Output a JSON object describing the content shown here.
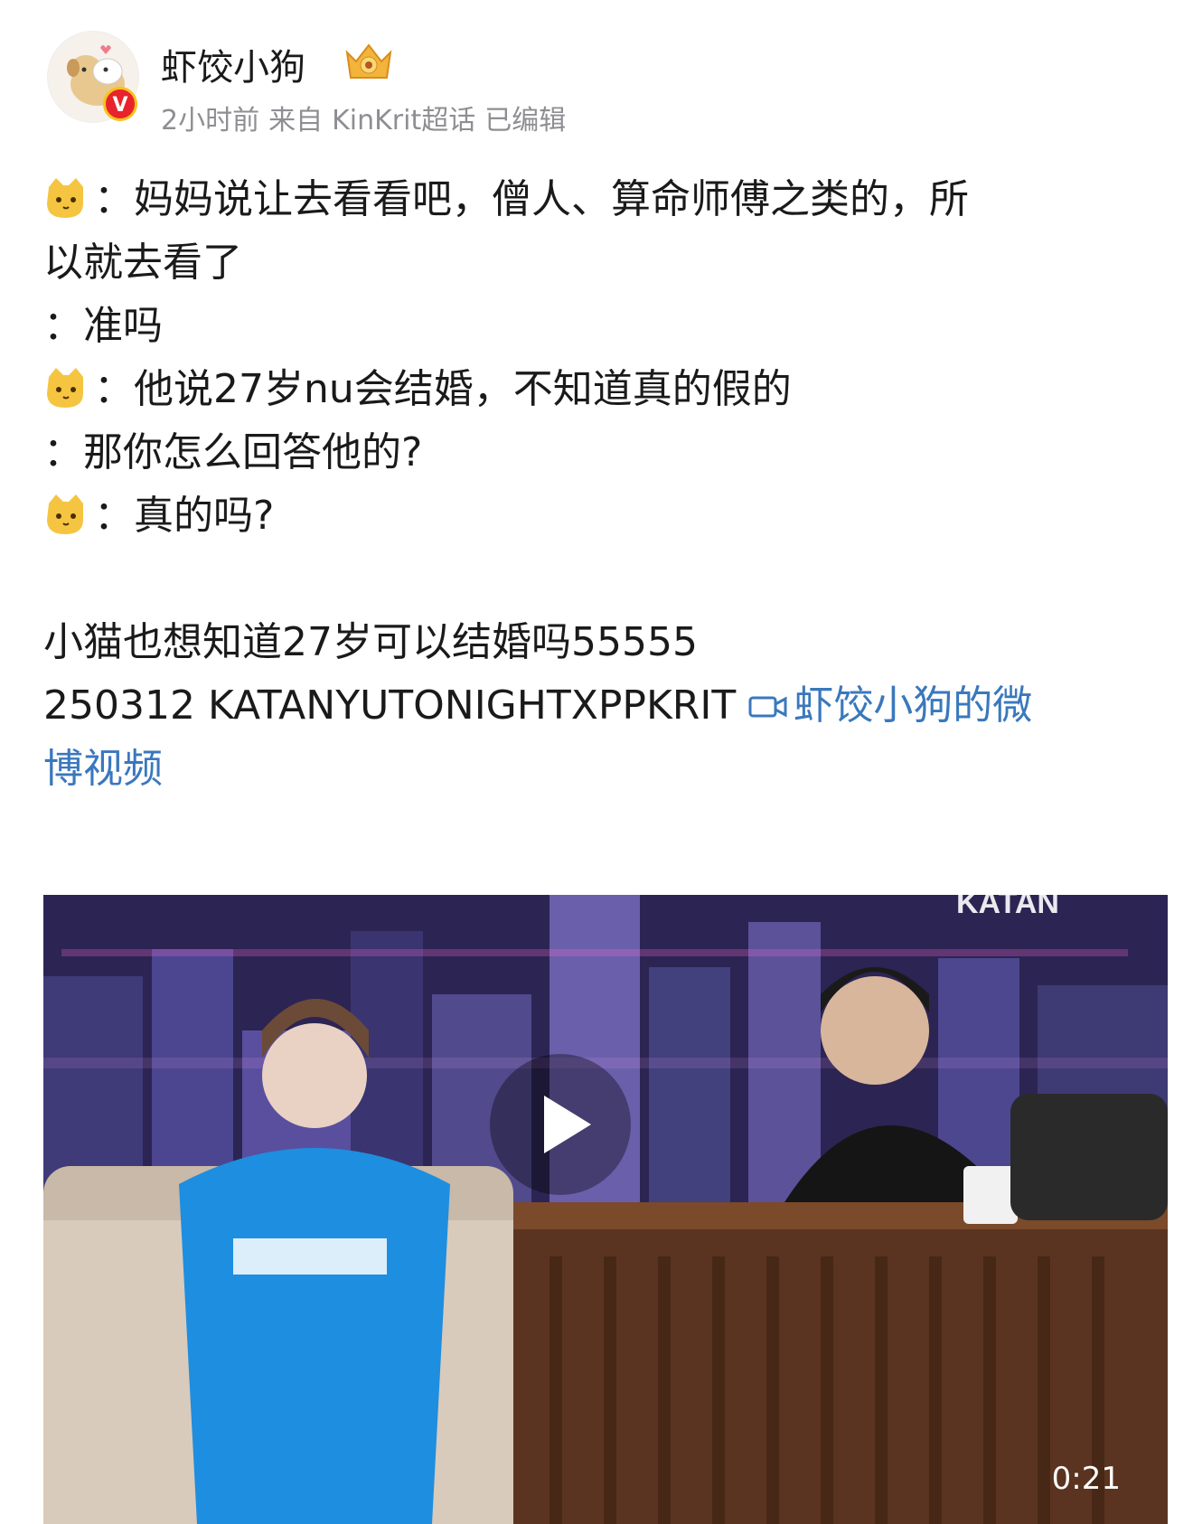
{
  "post": {
    "author": {
      "name": "虾饺小狗",
      "verified_badge": "V",
      "avatar_icon": "puppy-avatar",
      "crown_icon": "fan-crown-badge"
    },
    "meta": {
      "time": "2小时前",
      "source_prefix": "来自",
      "source": "KinKrit超话",
      "edited": "已编辑"
    },
    "lines": {
      "l1a": "：妈妈说让去看看吧，僧人、算命师傅之类的，所",
      "l1b": "以就去看了",
      "l2": "：准吗",
      "l3": "：他说27岁nu会结婚，不知道真的假的",
      "l4": "：那你怎么回答他的?",
      "l5": "：真的吗?",
      "l6": "小猫也想知道27岁可以结婚吗55555",
      "l7": "250312 KATANYUTONIGHTXPPKRIT"
    },
    "video_link_a": "虾饺小狗的微",
    "video_link_b": "博视频",
    "video": {
      "duration": "0:21",
      "backdrop_text": "KATAN"
    },
    "colors": {
      "link": "#3a78bd",
      "meta_gray": "#8e8e93",
      "badge_red": "#e8232b"
    }
  }
}
